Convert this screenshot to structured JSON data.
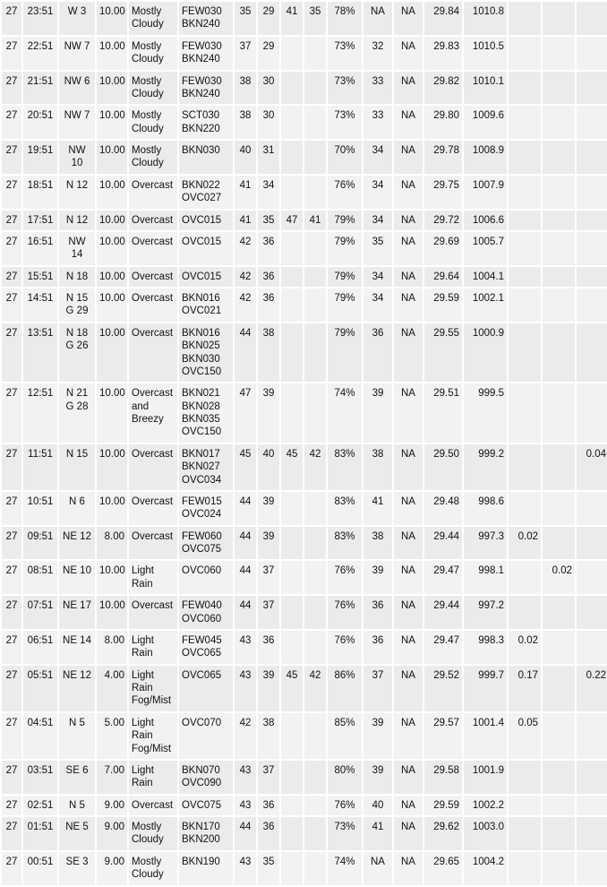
{
  "table": {
    "columns": [
      {
        "key": "date",
        "class": "c-date"
      },
      {
        "key": "time",
        "class": "c-time"
      },
      {
        "key": "wind",
        "class": "c-wind"
      },
      {
        "key": "vis",
        "class": "c-vis"
      },
      {
        "key": "weather",
        "class": "c-weather"
      },
      {
        "key": "sky",
        "class": "c-sky"
      },
      {
        "key": "temp",
        "class": "c-temp"
      },
      {
        "key": "dew",
        "class": "c-dew"
      },
      {
        "key": "hx",
        "class": "c-hx"
      },
      {
        "key": "wc",
        "class": "c-wc"
      },
      {
        "key": "rh",
        "class": "c-rh"
      },
      {
        "key": "apt",
        "class": "c-apt"
      },
      {
        "key": "slpna",
        "class": "c-slp-na"
      },
      {
        "key": "alt",
        "class": "c-alt"
      },
      {
        "key": "slp",
        "class": "c-slp"
      },
      {
        "key": "p1",
        "class": "c-p1"
      },
      {
        "key": "p3",
        "class": "c-p3"
      },
      {
        "key": "p6",
        "class": "c-p6"
      }
    ],
    "widths": [
      22,
      38,
      40,
      34,
      54,
      60,
      24,
      24,
      24,
      24,
      38,
      32,
      32,
      42,
      48,
      36,
      36,
      36
    ],
    "rows": [
      {
        "date": "27",
        "time": "23:51",
        "wind": "W 3",
        "vis": "10.00",
        "weather": "Mostly Cloudy",
        "sky": "FEW030 BKN240",
        "temp": "35",
        "dew": "29",
        "hx": "41",
        "wc": "35",
        "rh": "78%",
        "apt": "NA",
        "slpna": "NA",
        "alt": "29.84",
        "slp": "1010.8",
        "p1": "",
        "p3": "",
        "p6": ""
      },
      {
        "date": "27",
        "time": "22:51",
        "wind": "NW 7",
        "vis": "10.00",
        "weather": "Mostly Cloudy",
        "sky": "FEW030 BKN240",
        "temp": "37",
        "dew": "29",
        "hx": "",
        "wc": "",
        "rh": "73%",
        "apt": "32",
        "slpna": "NA",
        "alt": "29.83",
        "slp": "1010.5",
        "p1": "",
        "p3": "",
        "p6": ""
      },
      {
        "date": "27",
        "time": "21:51",
        "wind": "NW 6",
        "vis": "10.00",
        "weather": "Mostly Cloudy",
        "sky": "FEW030 BKN240",
        "temp": "38",
        "dew": "30",
        "hx": "",
        "wc": "",
        "rh": "73%",
        "apt": "33",
        "slpna": "NA",
        "alt": "29.82",
        "slp": "1010.1",
        "p1": "",
        "p3": "",
        "p6": ""
      },
      {
        "date": "27",
        "time": "20:51",
        "wind": "NW 7",
        "vis": "10.00",
        "weather": "Mostly Cloudy",
        "sky": "SCT030 BKN220",
        "temp": "38",
        "dew": "30",
        "hx": "",
        "wc": "",
        "rh": "73%",
        "apt": "33",
        "slpna": "NA",
        "alt": "29.80",
        "slp": "1009.6",
        "p1": "",
        "p3": "",
        "p6": ""
      },
      {
        "date": "27",
        "time": "19:51",
        "wind": "NW 10",
        "vis": "10.00",
        "weather": "Mostly Cloudy",
        "sky": "BKN030",
        "temp": "40",
        "dew": "31",
        "hx": "",
        "wc": "",
        "rh": "70%",
        "apt": "34",
        "slpna": "NA",
        "alt": "29.78",
        "slp": "1008.9",
        "p1": "",
        "p3": "",
        "p6": ""
      },
      {
        "date": "27",
        "time": "18:51",
        "wind": "N 12",
        "vis": "10.00",
        "weather": "Overcast",
        "sky": "BKN022 OVC027",
        "temp": "41",
        "dew": "34",
        "hx": "",
        "wc": "",
        "rh": "76%",
        "apt": "34",
        "slpna": "NA",
        "alt": "29.75",
        "slp": "1007.9",
        "p1": "",
        "p3": "",
        "p6": ""
      },
      {
        "date": "27",
        "time": "17:51",
        "wind": "N 12",
        "vis": "10.00",
        "weather": "Overcast",
        "sky": "OVC015",
        "temp": "41",
        "dew": "35",
        "hx": "47",
        "wc": "41",
        "rh": "79%",
        "apt": "34",
        "slpna": "NA",
        "alt": "29.72",
        "slp": "1006.6",
        "p1": "",
        "p3": "",
        "p6": ""
      },
      {
        "date": "27",
        "time": "16:51",
        "wind": "NW 14",
        "vis": "10.00",
        "weather": "Overcast",
        "sky": "OVC015",
        "temp": "42",
        "dew": "36",
        "hx": "",
        "wc": "",
        "rh": "79%",
        "apt": "35",
        "slpna": "NA",
        "alt": "29.69",
        "slp": "1005.7",
        "p1": "",
        "p3": "",
        "p6": ""
      },
      {
        "date": "27",
        "time": "15:51",
        "wind": "N 18",
        "vis": "10.00",
        "weather": "Overcast",
        "sky": "OVC015",
        "temp": "42",
        "dew": "36",
        "hx": "",
        "wc": "",
        "rh": "79%",
        "apt": "34",
        "slpna": "NA",
        "alt": "29.64",
        "slp": "1004.1",
        "p1": "",
        "p3": "",
        "p6": ""
      },
      {
        "date": "27",
        "time": "14:51",
        "wind": "N 15 G 29",
        "vis": "10.00",
        "weather": "Overcast",
        "sky": "BKN016 OVC021",
        "temp": "42",
        "dew": "36",
        "hx": "",
        "wc": "",
        "rh": "79%",
        "apt": "34",
        "slpna": "NA",
        "alt": "29.59",
        "slp": "1002.1",
        "p1": "",
        "p3": "",
        "p6": ""
      },
      {
        "date": "27",
        "time": "13:51",
        "wind": "N 18 G 26",
        "vis": "10.00",
        "weather": "Overcast",
        "sky": "BKN016 BKN025 BKN030 OVC150",
        "temp": "44",
        "dew": "38",
        "hx": "",
        "wc": "",
        "rh": "79%",
        "apt": "36",
        "slpna": "NA",
        "alt": "29.55",
        "slp": "1000.9",
        "p1": "",
        "p3": "",
        "p6": ""
      },
      {
        "date": "27",
        "time": "12:51",
        "wind": "N 21 G 28",
        "vis": "10.00",
        "weather": "Overcast and Breezy",
        "sky": "BKN021 BKN028 BKN035 OVC150",
        "temp": "47",
        "dew": "39",
        "hx": "",
        "wc": "",
        "rh": "74%",
        "apt": "39",
        "slpna": "NA",
        "alt": "29.51",
        "slp": "999.5",
        "p1": "",
        "p3": "",
        "p6": ""
      },
      {
        "date": "27",
        "time": "11:51",
        "wind": "N 15",
        "vis": "10.00",
        "weather": "Overcast",
        "sky": "BKN017 BKN027 OVC034",
        "temp": "45",
        "dew": "40",
        "hx": "45",
        "wc": "42",
        "rh": "83%",
        "apt": "38",
        "slpna": "NA",
        "alt": "29.50",
        "slp": "999.2",
        "p1": "",
        "p3": "",
        "p6": "0.04"
      },
      {
        "date": "27",
        "time": "10:51",
        "wind": "N 6",
        "vis": "10.00",
        "weather": "Overcast",
        "sky": "FEW015 OVC024",
        "temp": "44",
        "dew": "39",
        "hx": "",
        "wc": "",
        "rh": "83%",
        "apt": "41",
        "slpna": "NA",
        "alt": "29.48",
        "slp": "998.6",
        "p1": "",
        "p3": "",
        "p6": ""
      },
      {
        "date": "27",
        "time": "09:51",
        "wind": "NE 12",
        "vis": "8.00",
        "weather": "Overcast",
        "sky": "FEW060 OVC075",
        "temp": "44",
        "dew": "39",
        "hx": "",
        "wc": "",
        "rh": "83%",
        "apt": "38",
        "slpna": "NA",
        "alt": "29.44",
        "slp": "997.3",
        "p1": "0.02",
        "p3": "",
        "p6": ""
      },
      {
        "date": "27",
        "time": "08:51",
        "wind": "NE 10",
        "vis": "10.00",
        "weather": "Light Rain",
        "sky": "OVC060",
        "temp": "44",
        "dew": "37",
        "hx": "",
        "wc": "",
        "rh": "76%",
        "apt": "39",
        "slpna": "NA",
        "alt": "29.47",
        "slp": "998.1",
        "p1": "",
        "p3": "0.02",
        "p6": ""
      },
      {
        "date": "27",
        "time": "07:51",
        "wind": "NE 17",
        "vis": "10.00",
        "weather": "Overcast",
        "sky": "FEW040 OVC060",
        "temp": "44",
        "dew": "37",
        "hx": "",
        "wc": "",
        "rh": "76%",
        "apt": "36",
        "slpna": "NA",
        "alt": "29.44",
        "slp": "997.2",
        "p1": "",
        "p3": "",
        "p6": ""
      },
      {
        "date": "27",
        "time": "06:51",
        "wind": "NE 14",
        "vis": "8.00",
        "weather": "Light Rain",
        "sky": "FEW045 OVC065",
        "temp": "43",
        "dew": "36",
        "hx": "",
        "wc": "",
        "rh": "76%",
        "apt": "36",
        "slpna": "NA",
        "alt": "29.47",
        "slp": "998.3",
        "p1": "0.02",
        "p3": "",
        "p6": ""
      },
      {
        "date": "27",
        "time": "05:51",
        "wind": "NE 12",
        "vis": "4.00",
        "weather": "Light Rain Fog/Mist",
        "sky": "OVC065",
        "temp": "43",
        "dew": "39",
        "hx": "45",
        "wc": "42",
        "rh": "86%",
        "apt": "37",
        "slpna": "NA",
        "alt": "29.52",
        "slp": "999.7",
        "p1": "0.17",
        "p3": "",
        "p6": "0.22"
      },
      {
        "date": "27",
        "time": "04:51",
        "wind": "N 5",
        "vis": "5.00",
        "weather": "Light Rain Fog/Mist",
        "sky": "OVC070",
        "temp": "42",
        "dew": "38",
        "hx": "",
        "wc": "",
        "rh": "85%",
        "apt": "39",
        "slpna": "NA",
        "alt": "29.57",
        "slp": "1001.4",
        "p1": "0.05",
        "p3": "",
        "p6": ""
      },
      {
        "date": "27",
        "time": "03:51",
        "wind": "SE 6",
        "vis": "7.00",
        "weather": "Light Rain",
        "sky": "BKN070 OVC090",
        "temp": "43",
        "dew": "37",
        "hx": "",
        "wc": "",
        "rh": "80%",
        "apt": "39",
        "slpna": "NA",
        "alt": "29.58",
        "slp": "1001.9",
        "p1": "",
        "p3": "",
        "p6": ""
      },
      {
        "date": "27",
        "time": "02:51",
        "wind": "N 5",
        "vis": "9.00",
        "weather": "Overcast",
        "sky": "OVC075",
        "temp": "43",
        "dew": "36",
        "hx": "",
        "wc": "",
        "rh": "76%",
        "apt": "40",
        "slpna": "NA",
        "alt": "29.59",
        "slp": "1002.2",
        "p1": "",
        "p3": "",
        "p6": ""
      },
      {
        "date": "27",
        "time": "01:51",
        "wind": "NE 5",
        "vis": "9.00",
        "weather": "Mostly Cloudy",
        "sky": "BKN170 BKN200",
        "temp": "44",
        "dew": "36",
        "hx": "",
        "wc": "",
        "rh": "73%",
        "apt": "41",
        "slpna": "NA",
        "alt": "29.62",
        "slp": "1003.0",
        "p1": "",
        "p3": "",
        "p6": ""
      },
      {
        "date": "27",
        "time": "00:51",
        "wind": "SE 3",
        "vis": "9.00",
        "weather": "Mostly Cloudy",
        "sky": "BKN190",
        "temp": "43",
        "dew": "35",
        "hx": "",
        "wc": "",
        "rh": "74%",
        "apt": "NA",
        "slpna": "NA",
        "alt": "29.65",
        "slp": "1004.2",
        "p1": "",
        "p3": "",
        "p6": ""
      }
    ]
  }
}
